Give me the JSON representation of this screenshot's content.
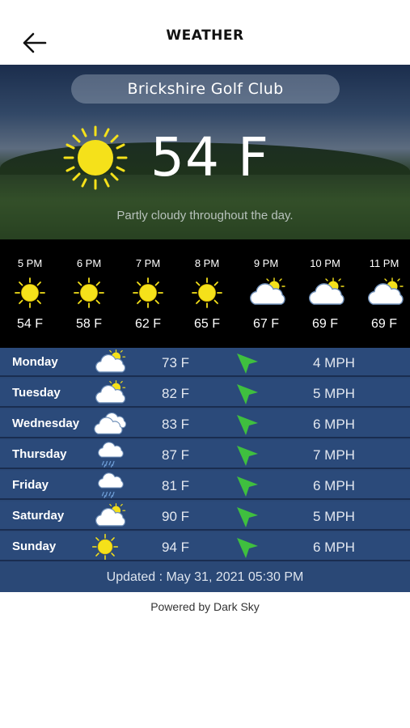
{
  "header": {
    "title": "WEATHER",
    "back_icon": "arrow-left-icon"
  },
  "current": {
    "club": "Brickshire Golf Club",
    "temp": "54 F",
    "summary": "Partly cloudy throughout the day.",
    "icon": "sun-icon"
  },
  "hourly": [
    {
      "time": "5 PM",
      "temp": "54 F",
      "icon": "sun-icon"
    },
    {
      "time": "6 PM",
      "temp": "58 F",
      "icon": "sun-icon"
    },
    {
      "time": "7 PM",
      "temp": "62 F",
      "icon": "sun-icon"
    },
    {
      "time": "8 PM",
      "temp": "65 F",
      "icon": "sun-icon"
    },
    {
      "time": "9 PM",
      "temp": "67 F",
      "icon": "partly-cloudy-icon"
    },
    {
      "time": "10 PM",
      "temp": "69 F",
      "icon": "partly-cloudy-icon"
    },
    {
      "time": "11 PM",
      "temp": "69 F",
      "icon": "partly-cloudy-icon"
    }
  ],
  "daily": [
    {
      "day": "Monday",
      "temp": "73 F",
      "wind": "4 MPH",
      "icon": "partly-cloudy-icon"
    },
    {
      "day": "Tuesday",
      "temp": "82 F",
      "wind": "5 MPH",
      "icon": "partly-cloudy-icon"
    },
    {
      "day": "Wednesday",
      "temp": "83 F",
      "wind": "6 MPH",
      "icon": "cloudy-icon"
    },
    {
      "day": "Thursday",
      "temp": "87 F",
      "wind": "7 MPH",
      "icon": "rain-icon"
    },
    {
      "day": "Friday",
      "temp": "81 F",
      "wind": "6 MPH",
      "icon": "rain-icon"
    },
    {
      "day": "Saturday",
      "temp": "90 F",
      "wind": "5 MPH",
      "icon": "partly-cloudy-icon"
    },
    {
      "day": "Sunday",
      "temp": "94 F",
      "wind": "6 MPH",
      "icon": "sun-icon"
    }
  ],
  "updated": "Updated : May 31, 2021 05:30 PM",
  "powered_by": "Powered by Dark Sky",
  "colors": {
    "accent_blue": "#2b4a7a",
    "sun": "#f5e11a",
    "wind_arrow": "#3fbf3f",
    "hourly_bg": "#000000"
  }
}
